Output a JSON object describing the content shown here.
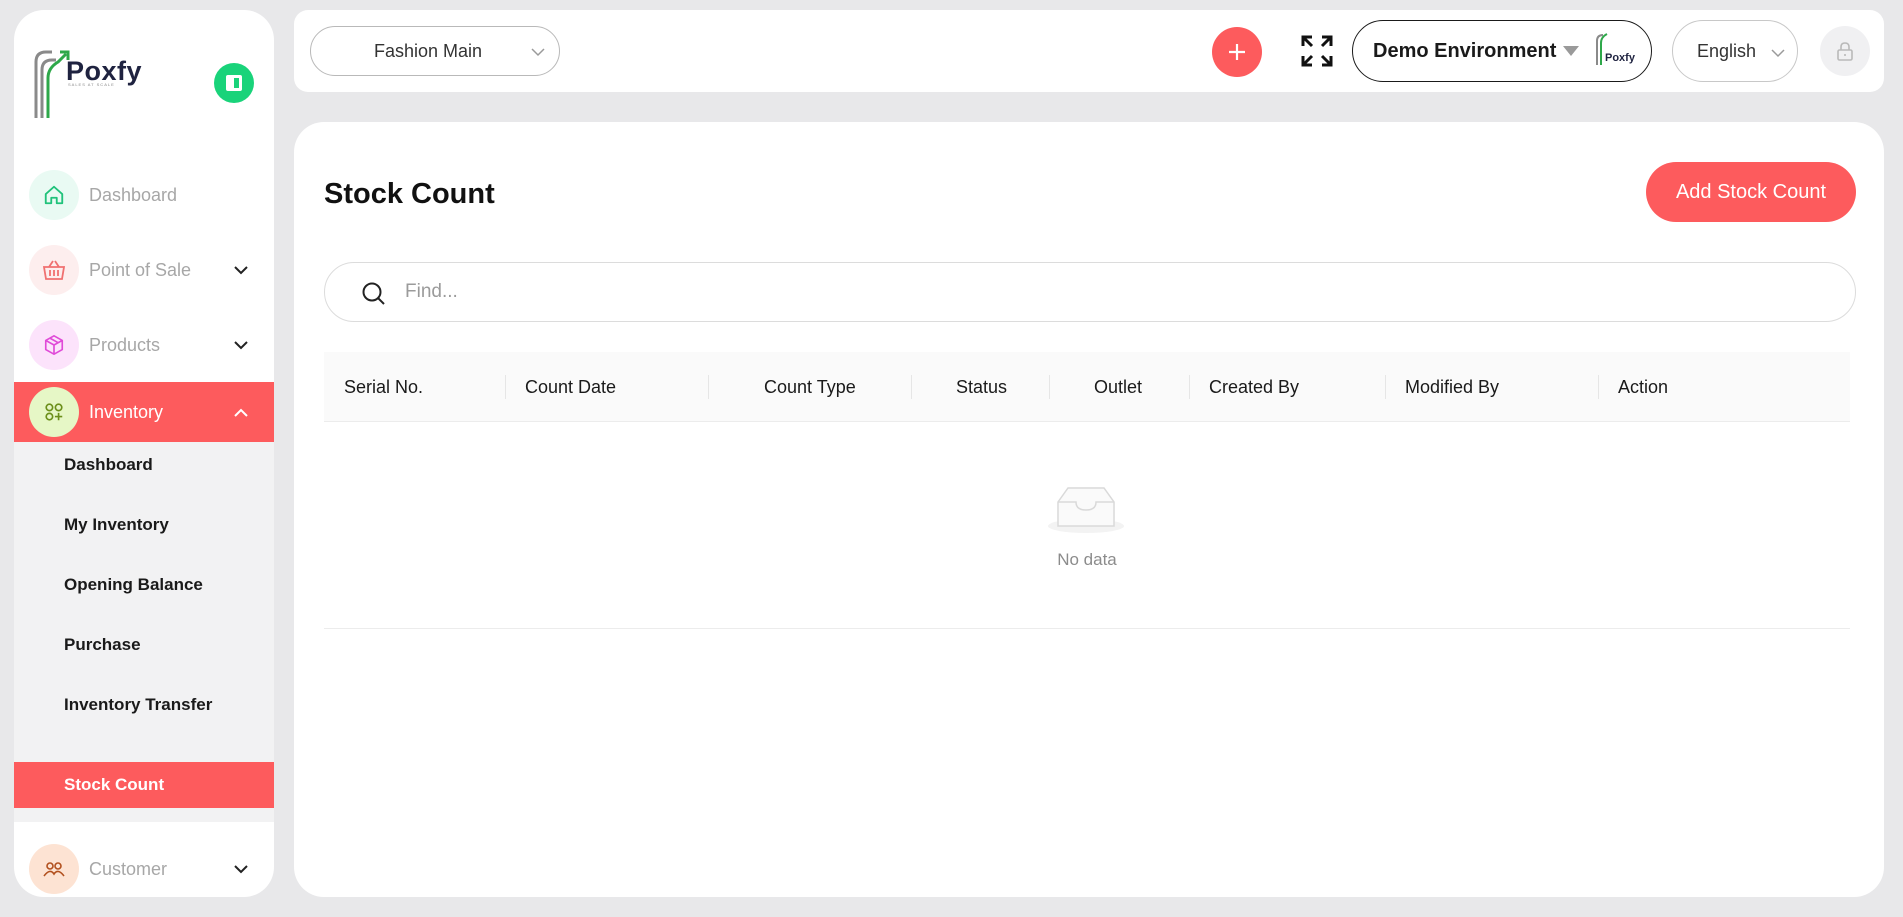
{
  "sidebar": {
    "logo_text": "Poxfy",
    "logo_subtext": "SALES AT SCALE",
    "nav": [
      {
        "label": "Dashboard",
        "icon": "home-icon",
        "has_chevron": false
      },
      {
        "label": "Point of Sale",
        "icon": "basket-icon",
        "has_chevron": true
      },
      {
        "label": "Products",
        "icon": "box-icon",
        "has_chevron": true
      },
      {
        "label": "Inventory",
        "icon": "grid-plus-icon",
        "has_chevron": true,
        "active": true
      },
      {
        "label": "Customer",
        "icon": "users-icon",
        "has_chevron": true
      }
    ],
    "inventory_submenu": [
      {
        "label": "Dashboard"
      },
      {
        "label": "My Inventory"
      },
      {
        "label": "Opening Balance"
      },
      {
        "label": "Purchase"
      },
      {
        "label": "Inventory Transfer"
      },
      {
        "label": "Stock Count",
        "active": true
      }
    ]
  },
  "topbar": {
    "outlet_value": "Fashion Main",
    "environment_value": "Demo Environment",
    "env_logo_text": "Poxfy",
    "language_value": "English"
  },
  "main": {
    "title": "Stock Count",
    "add_button_label": "Add Stock Count",
    "search_placeholder": "Find...",
    "columns": [
      "Serial No.",
      "Count Date",
      "Count Type",
      "Status",
      "Outlet",
      "Created By",
      "Modified By",
      "Action"
    ],
    "empty_text": "No data"
  },
  "colors": {
    "accent": "#fd5b5d",
    "green": "#19d37a",
    "background": "#e8e8ea"
  }
}
